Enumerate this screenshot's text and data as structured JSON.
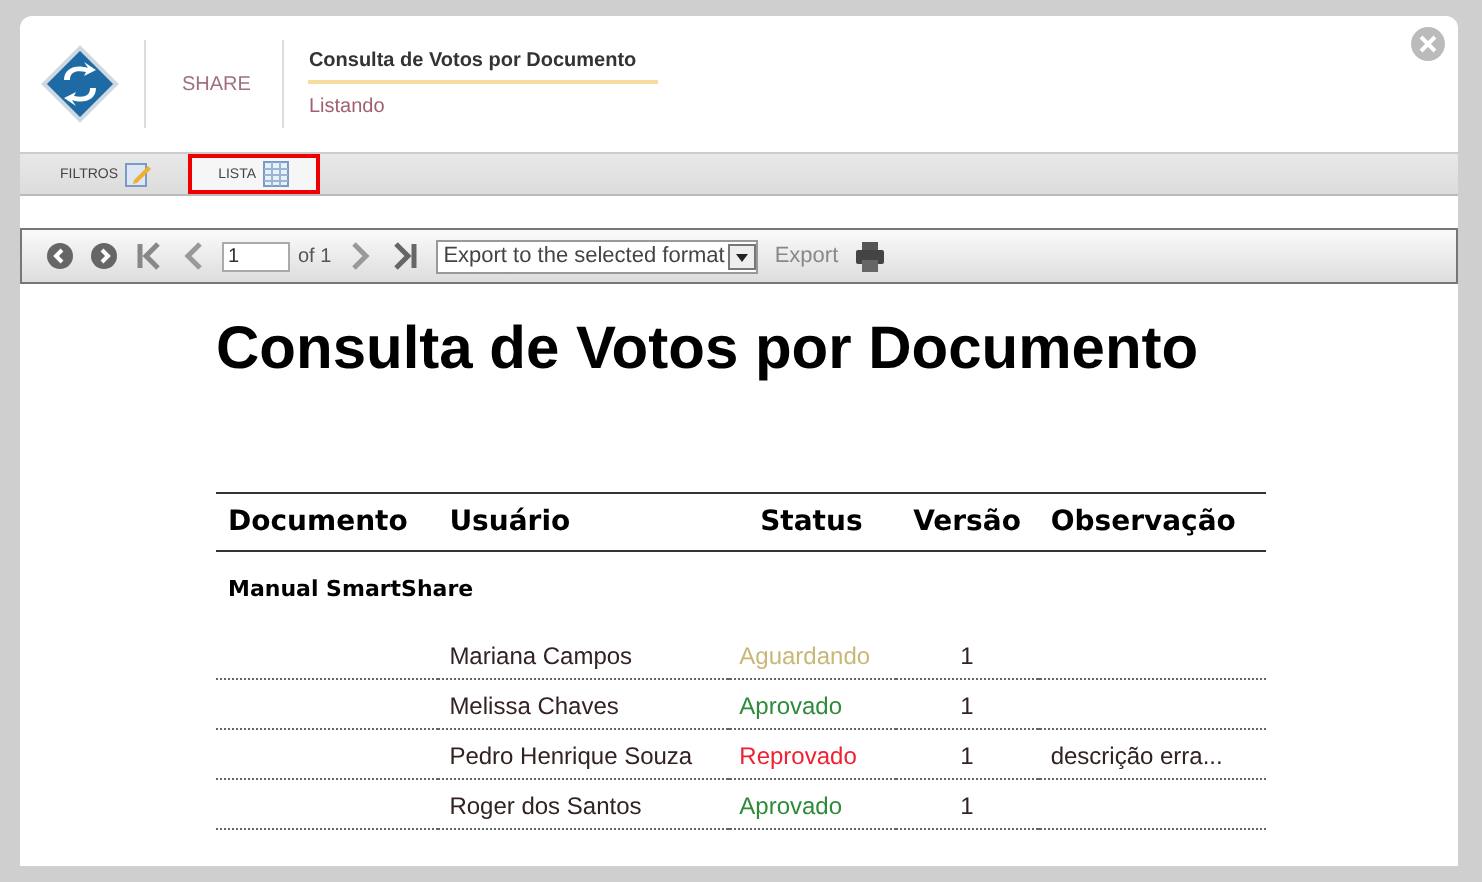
{
  "header": {
    "brand": "SHARE",
    "title": "Consulta de Votos por Documento",
    "subtitle": "Listando"
  },
  "tabs": [
    {
      "label": "FILTROS",
      "kind": "form",
      "selected": false
    },
    {
      "label": "LISTA",
      "kind": "grid",
      "selected": true
    }
  ],
  "toolbar": {
    "page": "1",
    "of": "of 1",
    "format": "Export to the selected format",
    "export": "Export"
  },
  "report": {
    "title": "Consulta de Votos por Documento",
    "columns": [
      "Documento",
      "Usuário",
      "Status",
      "Versão",
      "Observação"
    ],
    "group": "Manual SmartShare",
    "rows": [
      {
        "user": "Mariana Campos",
        "status": "Aguardando",
        "color": "#c8b878",
        "version": "1"
      },
      {
        "user": "Melissa Chaves",
        "status": "Aprovado",
        "color": "#2e8b3a",
        "version": "1"
      },
      {
        "user": "Pedro Henrique Souza",
        "status": "Reprovado",
        "color": "#ee2233",
        "version": "1",
        "note": "descrição erra..."
      },
      {
        "user": "Roger dos Santos",
        "status": "Aprovado",
        "color": "#2e8b3a",
        "version": "1"
      }
    ]
  }
}
